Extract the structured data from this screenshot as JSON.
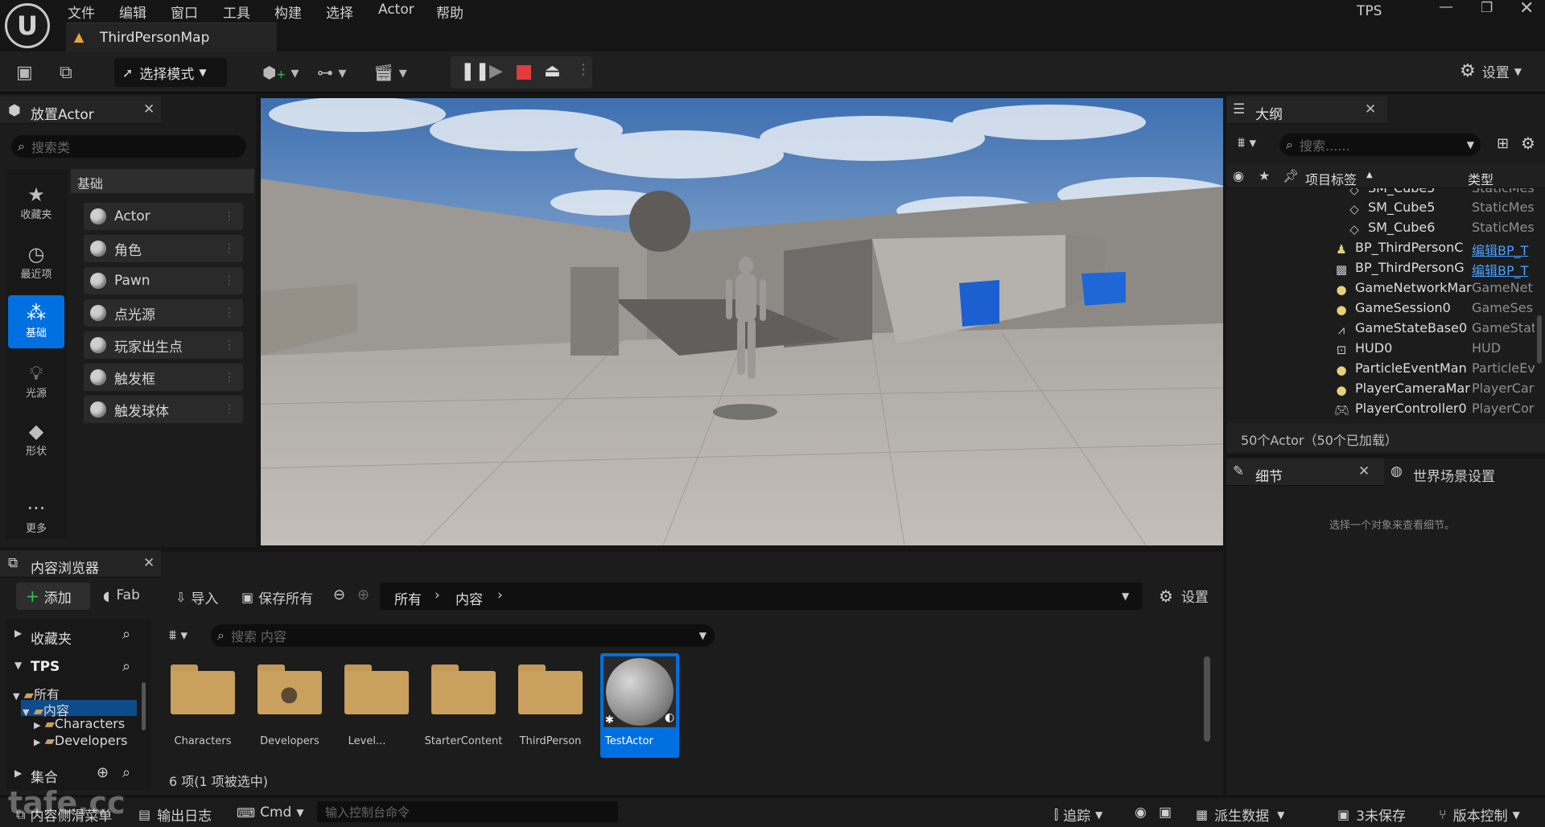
{
  "app": {
    "project": "TPS",
    "map_tab": "ThirdPersonMap"
  },
  "menu": [
    "文件",
    "编辑",
    "窗口",
    "工具",
    "构建",
    "选择",
    "Actor",
    "帮助"
  ],
  "toolbar": {
    "mode_label": "选择模式",
    "settings_label": "设置"
  },
  "place_actors": {
    "title": "放置Actor",
    "search_placeholder": "搜索类",
    "category": "基础",
    "nav": [
      {
        "label": "收藏夹",
        "icon": "star-icon"
      },
      {
        "label": "最近项",
        "icon": "clock-icon"
      },
      {
        "label": "基础",
        "icon": "shapes-icon",
        "active": true
      },
      {
        "label": "光源",
        "icon": "lightbulb-icon"
      },
      {
        "label": "形状",
        "icon": "cube-icon"
      },
      {
        "label": "更多",
        "icon": "more-icon"
      }
    ],
    "items": [
      "Actor",
      "角色",
      "Pawn",
      "点光源",
      "玩家出生点",
      "触发框",
      "触发球体"
    ]
  },
  "outliner": {
    "title": "大纲",
    "search_placeholder": "搜索......",
    "col_label": "项目标签",
    "col_type": "类型",
    "partial_name": "SM_Cube5",
    "partial_type": "StaticMes",
    "rows": [
      {
        "name": "SM_Cube5",
        "type": "StaticMes",
        "icon": "static-mesh-icon",
        "link": false
      },
      {
        "name": "SM_Cube6",
        "type": "StaticMes",
        "icon": "static-mesh-icon",
        "link": false
      },
      {
        "name": "BP_ThirdPersonC",
        "type": "编辑BP_T",
        "icon": "character-icon",
        "link": true
      },
      {
        "name": "BP_ThirdPersonG",
        "type": "编辑BP_T",
        "icon": "gamemode-icon",
        "link": true
      },
      {
        "name": "GameNetworkMar",
        "type": "GameNet",
        "icon": "actor-icon",
        "link": false
      },
      {
        "name": "GameSession0",
        "type": "GameSes",
        "icon": "actor-icon",
        "link": false
      },
      {
        "name": "GameStateBase0",
        "type": "GameStat",
        "icon": "gamestate-icon",
        "link": false
      },
      {
        "name": "HUD0",
        "type": "HUD",
        "icon": "hud-icon",
        "link": false
      },
      {
        "name": "ParticleEventMan",
        "type": "ParticleEv",
        "icon": "actor-icon",
        "link": false
      },
      {
        "name": "PlayerCameraMar",
        "type": "PlayerCar",
        "icon": "actor-icon",
        "link": false
      },
      {
        "name": "PlayerController0",
        "type": "PlayerCor",
        "icon": "controller-icon",
        "link": false
      }
    ],
    "count": "50个Actor（50个已加载）"
  },
  "details": {
    "title": "细节",
    "world_settings": "世界场景设置",
    "empty_hint": "选择一个对象来查看细节。"
  },
  "content_browser": {
    "title": "内容浏览器",
    "add": "添加",
    "fab": "Fab",
    "import": "导入",
    "save_all": "保存所有",
    "path": [
      "所有",
      "内容"
    ],
    "settings": "设置",
    "favorites": "收藏夹",
    "project": "TPS",
    "tree": [
      "所有",
      "内容",
      "Characters",
      "Developers"
    ],
    "collections": "集合",
    "search_placeholder": "搜索 内容",
    "assets": [
      {
        "label": "Characters",
        "kind": "folder"
      },
      {
        "label": "Developers",
        "kind": "folder-user"
      },
      {
        "label": "Level...",
        "kind": "folder"
      },
      {
        "label": "StarterContent",
        "kind": "folder"
      },
      {
        "label": "ThirdPerson",
        "kind": "folder"
      },
      {
        "label": "TestActor",
        "kind": "blueprint",
        "selected": true
      }
    ],
    "status": "6 项(1 项被选中)"
  },
  "statusbar": {
    "drawer": "内容侧滑菜单",
    "log": "输出日志",
    "cmd": "Cmd",
    "console_placeholder": "输入控制台命令",
    "trace": "追踪",
    "derived": "派生数据",
    "unsaved": "3未保存",
    "source_control": "版本控制"
  },
  "watermark": "tafe.cc",
  "colors": {
    "accent": "#0070e0",
    "stop": "#e23b3b",
    "link": "#4aa0ff",
    "folder": "#c9a05e"
  }
}
